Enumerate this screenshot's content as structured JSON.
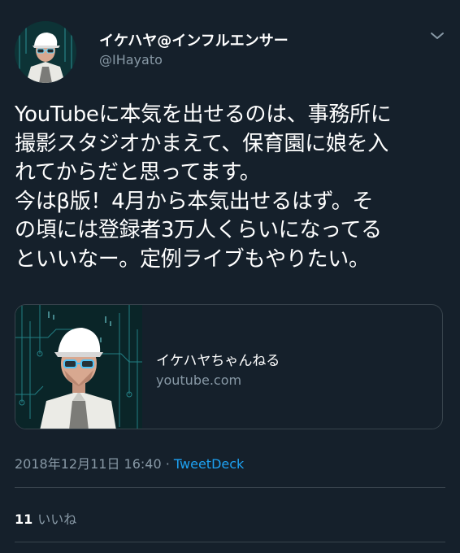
{
  "tweet": {
    "author": {
      "display_name": "イケハヤ@インフルエンサー",
      "handle": "@IHayato"
    },
    "text_lines": [
      "YouTubeに本気を出せるのは、事務所に",
      "撮影スタジオかまえて、保育園に娘を入",
      "れてからだと思ってます。",
      "今はβ版！4月から本気出せるはず。そ",
      "の頃には登録者3万人くらいになってる",
      "といいなー。定例ライブもやりたい。"
    ],
    "card": {
      "title": "イケハヤちゃんねる",
      "domain": "youtube.com"
    },
    "timestamp": "2018年12月11日 16:40",
    "separator": " · ",
    "source": "TweetDeck",
    "likes": {
      "count": "11",
      "label": "いいね"
    }
  },
  "colors": {
    "background": "#15202b",
    "primary_text": "#ffffff",
    "secondary_text": "#8899a6",
    "link": "#1da1f2",
    "border": "#38444d"
  },
  "icons": {
    "menu": "chevron-down-icon"
  }
}
